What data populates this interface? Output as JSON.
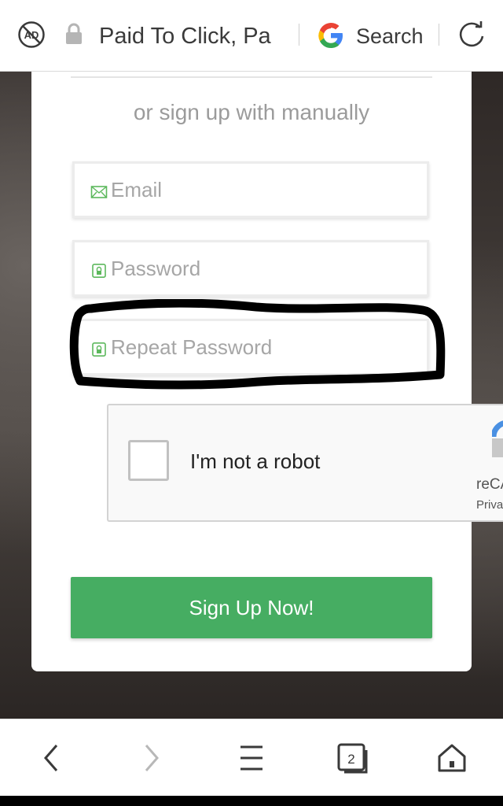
{
  "browser": {
    "tab_title": "Paid To Click, Pa",
    "search_label": "Search",
    "ad_icon_text": "AD",
    "tabs_count": "2"
  },
  "form": {
    "subtitle": "or sign up with manually",
    "email_placeholder": "Email",
    "password_placeholder": "Password",
    "repeat_password_placeholder": "Repeat Password",
    "submit_label": "Sign Up Now!"
  },
  "recaptcha": {
    "label": "I'm not a robot",
    "brand": "reCA",
    "privacy": "Priva"
  },
  "colors": {
    "accent": "#46ad62",
    "icon_green": "#5cb85c",
    "marker": "#000000"
  },
  "icons": {
    "email": "envelope-icon",
    "password": "lock-icon",
    "repeat_password": "lock-icon",
    "nav": [
      "back-icon",
      "forward-icon",
      "menu-icon",
      "tabs-icon",
      "home-icon"
    ]
  }
}
